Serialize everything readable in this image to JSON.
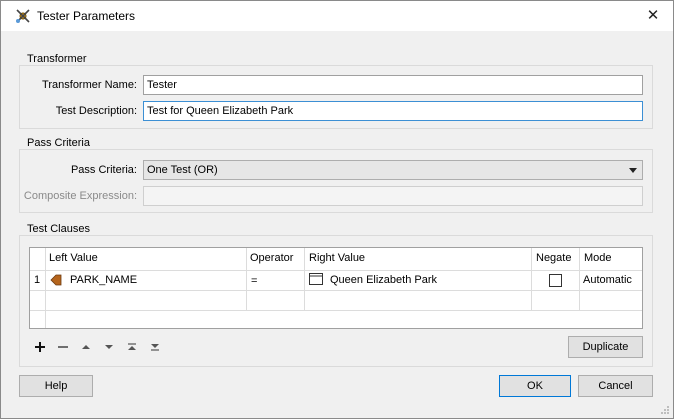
{
  "window": {
    "title": "Tester Parameters",
    "close_glyph": "✕",
    "icon": "tester-transformer-icon"
  },
  "transformer_group": {
    "title": "Transformer",
    "name_label": "Transformer Name:",
    "name_value": "Tester",
    "description_label": "Test Description:",
    "description_value": "Test for Queen Elizabeth Park"
  },
  "pass_criteria_group": {
    "title": "Pass Criteria",
    "criteria_label": "Pass Criteria:",
    "criteria_value": "One Test (OR)",
    "composite_label": "Composite Expression:",
    "composite_value": ""
  },
  "test_clauses_group": {
    "title": "Test Clauses",
    "columns": {
      "left_value": "Left Value",
      "operator": "Operator",
      "right_value": "Right Value",
      "negate": "Negate",
      "mode": "Mode"
    },
    "rows": [
      {
        "number": "1",
        "left_value": "PARK_NAME",
        "operator": "=",
        "right_value": "Queen Elizabeth Park",
        "negate": false,
        "mode": "Automatic"
      }
    ],
    "toolbar": {
      "add_glyph": "+",
      "remove_glyph": "—",
      "duplicate_label": "Duplicate"
    }
  },
  "footer": {
    "help_label": "Help",
    "ok_label": "OK",
    "cancel_label": "Cancel"
  },
  "colors": {
    "dialog_bg": "#f0f0f0",
    "focus_border": "#3c8fd4",
    "default_button_border": "#0078d7",
    "attribute_icon": "#b5651d"
  }
}
